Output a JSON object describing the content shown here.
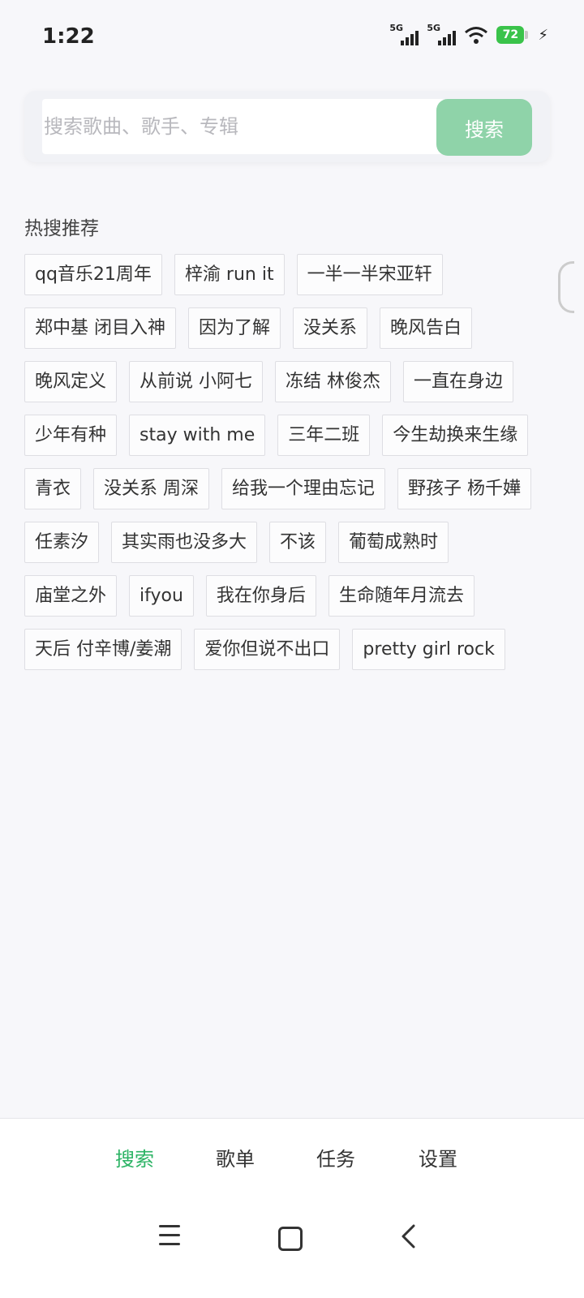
{
  "status_bar": {
    "time": "1:22",
    "signal1_label": "5G",
    "signal2_label": "5G",
    "wifi_icon": "wifi-icon",
    "battery_level": "72",
    "charging_icon": "bolt-icon"
  },
  "search": {
    "placeholder": "搜索歌曲、歌手、专辑",
    "value": "",
    "button_label": "搜索"
  },
  "hot": {
    "title": "热搜推荐",
    "tags": [
      "qq音乐21周年",
      "梓渝 run it",
      "一半一半宋亚轩",
      "郑中基 闭目入神",
      "因为了解",
      "没关系",
      "晚风告白",
      "晚风定义",
      "从前说 小阿七",
      "冻结 林俊杰",
      "一直在身边",
      "少年有种",
      "stay with me",
      "三年二班",
      "今生劫换来生缘",
      "青衣",
      "没关系 周深",
      "给我一个理由忘记",
      "野孩子 杨千嬅",
      "任素汐",
      "其实雨也没多大",
      "不该",
      "葡萄成熟时",
      "庙堂之外",
      "ifyou",
      "我在你身后",
      "生命随年月流去",
      "天后 付辛博/姜潮",
      "爱你但说不出口",
      "pretty girl rock"
    ]
  },
  "bottom_nav": {
    "items": [
      "搜索",
      "歌单",
      "任务",
      "设置"
    ],
    "active_color": "#2bb364"
  },
  "colors": {
    "accent": "#8fd3a9",
    "background": "#f7f7fa"
  }
}
